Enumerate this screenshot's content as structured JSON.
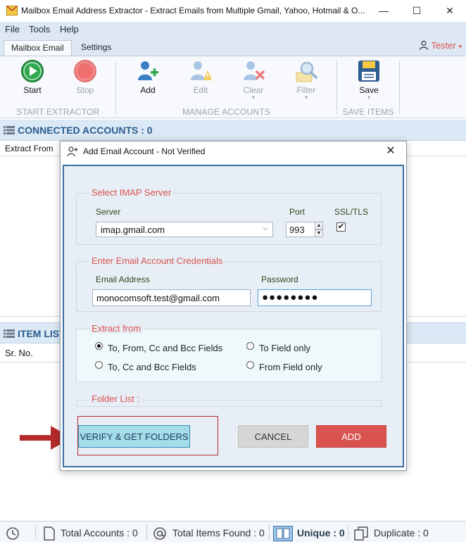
{
  "window": {
    "title": "Mailbox Email Address Extractor - Extract Emails from Multiple Gmail, Yahoo, Hotmail & O...",
    "minimize": "—",
    "maximize": "☐",
    "close": "✕"
  },
  "menu": {
    "file": "File",
    "tools": "Tools",
    "help": "Help"
  },
  "tabs": {
    "mailbox": "Mailbox Email",
    "settings": "Settings"
  },
  "user": {
    "name": "Tester",
    "caret": "▾"
  },
  "ribbon": {
    "start": "Start",
    "stop": "Stop",
    "add": "Add",
    "edit": "Edit",
    "clear": "Clear",
    "filter": "Filter",
    "save": "Save",
    "caret": "▾",
    "group_start": "START EXTRACTOR",
    "group_manage": "MANAGE ACCOUNTS",
    "group_save": "SAVE ITEMS"
  },
  "connected": {
    "title": "CONNECTED ACCOUNTS : 0",
    "col_extract_from": "Extract From"
  },
  "items": {
    "title": "ITEM LIST",
    "col_srno": "Sr. No."
  },
  "status": {
    "total_accounts": "Total Accounts : 0",
    "total_items": "Total Items Found : 0",
    "unique": "Unique : 0",
    "duplicate": "Duplicate : 0"
  },
  "dialog": {
    "title": "Add Email Account - Not Verified",
    "close": "✕",
    "imap_legend": "Select IMAP Server",
    "server_label": "Server",
    "server_value": "imap.gmail.com",
    "server_caret": "⌵",
    "port_label": "Port",
    "port_value": "993",
    "ssl_label": "SSL/TLS",
    "ssl_mark": "✔",
    "spin_up": "▲",
    "spin_down": "▼",
    "cred_legend": "Enter Email Account Credentials",
    "email_label": "Email Address",
    "email_value": "monocomsoft.test@gmail.com",
    "password_label": "Password",
    "password_value": "●●●●●●●●",
    "extract_legend": "Extract from",
    "opt_all": "To, From, Cc and Bcc Fields",
    "opt_to": "To Field only",
    "opt_tocc": "To, Cc and Bcc Fields",
    "opt_from": "From Field only",
    "folder_legend": "Folder List :",
    "verify_btn": "VERIFY & GET FOLDERS",
    "cancel_btn": "CANCEL",
    "add_btn": "ADD"
  },
  "colors": {
    "accent_red": "#d9534f",
    "header_blue": "#2c5d8f",
    "dialog_border": "#3b6ea3",
    "arrow": "#b52a2a"
  }
}
